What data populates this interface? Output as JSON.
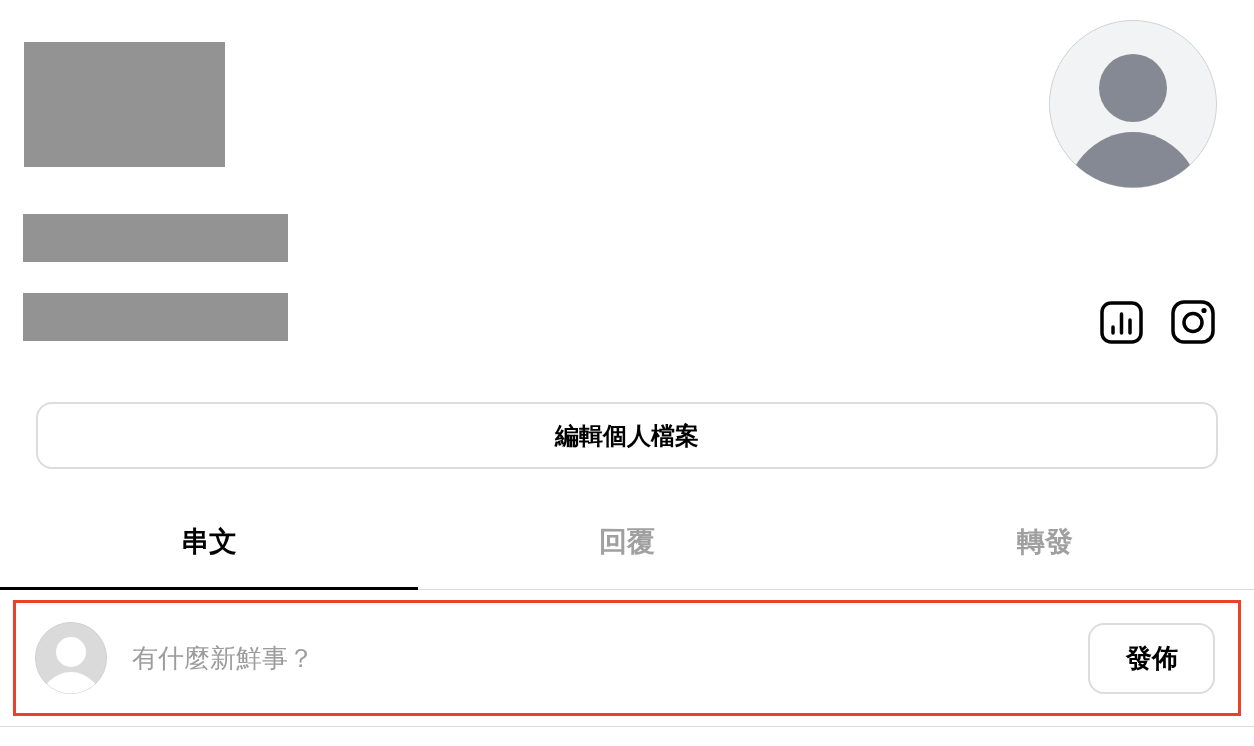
{
  "profile": {
    "edit_button": "編輯個人檔案"
  },
  "tabs": [
    {
      "label": "串文",
      "selected": true
    },
    {
      "label": "回覆",
      "selected": false
    },
    {
      "label": "轉發",
      "selected": false
    }
  ],
  "composer": {
    "placeholder": "有什麼新鮮事？",
    "post_button": "發佈"
  }
}
